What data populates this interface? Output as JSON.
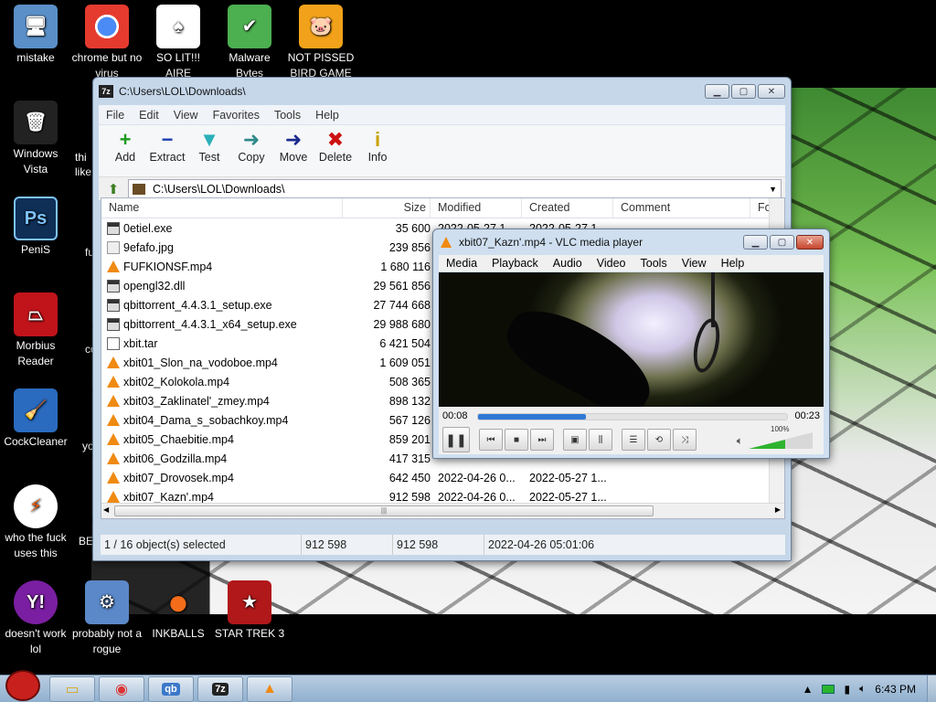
{
  "desktop": {
    "icons": [
      {
        "label": "mistake",
        "icon": "computer-icon"
      },
      {
        "label": "chrome but no virus",
        "icon": "chrome-icon"
      },
      {
        "label": "SO LIT!!! AIRE",
        "icon": "solitaire-icon"
      },
      {
        "label": "Malware Bytes",
        "icon": "shield-icon"
      },
      {
        "label": "NOT PISSED BIRD GAME",
        "icon": "pig-icon"
      },
      {
        "label": "Windows Vista",
        "icon": "trash-icon"
      },
      {
        "label": "PeniS",
        "icon": "photoshop-icon"
      },
      {
        "label": "Morbius Reader",
        "icon": "pdf-icon"
      },
      {
        "label": "CockCleaner",
        "icon": "broom-icon"
      },
      {
        "label": "who the fuck uses this",
        "icon": "lightning-icon"
      },
      {
        "label": "doesn't work lol",
        "icon": "yahoo-icon"
      },
      {
        "label": "probably not a rogue",
        "icon": "gears-icon"
      },
      {
        "label": "INKBALLS",
        "icon": "ball-icon"
      },
      {
        "label": "STAR TREK 3",
        "icon": "starwars-icon"
      }
    ],
    "partial_labels": [
      "thi",
      "like",
      "fu",
      "co",
      "yo",
      "BE"
    ]
  },
  "zip": {
    "title": "C:\\Users\\LOL\\Downloads\\",
    "title_icon": "7z",
    "menu": [
      "File",
      "Edit",
      "View",
      "Favorites",
      "Tools",
      "Help"
    ],
    "toolbar": [
      {
        "label": "Add",
        "icon": "+",
        "color": "#1f9b1f"
      },
      {
        "label": "Extract",
        "icon": "−",
        "color": "#1d3fb0"
      },
      {
        "label": "Test",
        "icon": "▼",
        "color": "#2bb0b8"
      },
      {
        "label": "Copy",
        "icon": "➜",
        "color": "#2f8a8a"
      },
      {
        "label": "Move",
        "icon": "➜",
        "color": "#1a2b8f"
      },
      {
        "label": "Delete",
        "icon": "✖",
        "color": "#cc1111"
      },
      {
        "label": "Info",
        "icon": "i",
        "color": "#c9a300"
      }
    ],
    "address": "C:\\Users\\LOL\\Downloads\\",
    "columns": [
      "Name",
      "Size",
      "Modified",
      "Created",
      "Comment",
      "Fo"
    ],
    "files": [
      {
        "name": "0etiel.exe",
        "size": "35 600",
        "modified": "2022-05-27 1...",
        "created": "2022-05-27 1...",
        "type": "exe"
      },
      {
        "name": "9efafo.jpg",
        "size": "239 856",
        "modified": "",
        "created": "",
        "type": "img"
      },
      {
        "name": "FUFKIONSF.mp4",
        "size": "1 680 116",
        "modified": "",
        "created": "",
        "type": "vlc"
      },
      {
        "name": "opengl32.dll",
        "size": "29 561 856",
        "modified": "",
        "created": "",
        "type": "exe"
      },
      {
        "name": "qbittorrent_4.4.3.1_setup.exe",
        "size": "27 744 668",
        "modified": "",
        "created": "",
        "type": "exe"
      },
      {
        "name": "qbittorrent_4.4.3.1_x64_setup.exe",
        "size": "29 988 680",
        "modified": "",
        "created": "",
        "type": "exe"
      },
      {
        "name": "xbit.tar",
        "size": "6 421 504",
        "modified": "",
        "created": "",
        "type": "tar"
      },
      {
        "name": "xbit01_Slon_na_vodoboe.mp4",
        "size": "1 609 051",
        "modified": "",
        "created": "",
        "type": "vlc"
      },
      {
        "name": "xbit02_Kolokola.mp4",
        "size": "508 365",
        "modified": "",
        "created": "",
        "type": "vlc"
      },
      {
        "name": "xbit03_Zaklinatel'_zmey.mp4",
        "size": "898 132",
        "modified": "",
        "created": "",
        "type": "vlc"
      },
      {
        "name": "xbit04_Dama_s_sobachkoy.mp4",
        "size": "567 126",
        "modified": "",
        "created": "",
        "type": "vlc"
      },
      {
        "name": "xbit05_Chaebitie.mp4",
        "size": "859 201",
        "modified": "",
        "created": "",
        "type": "vlc"
      },
      {
        "name": "xbit06_Godzilla.mp4",
        "size": "417 315",
        "modified": "",
        "created": "",
        "type": "vlc"
      },
      {
        "name": "xbit07_Drovosek.mp4",
        "size": "642 450",
        "modified": "2022-04-26 0...",
        "created": "2022-05-27 1...",
        "type": "vlc"
      },
      {
        "name": "xbit07_Kazn'.mp4",
        "size": "912 598",
        "modified": "2022-04-26 0...",
        "created": "2022-05-27 1...",
        "type": "vlc"
      }
    ],
    "status": [
      "1 / 16 object(s) selected",
      "912 598",
      "912 598",
      "2022-04-26 05:01:06"
    ]
  },
  "vlc": {
    "title": "xbit07_Kazn'.mp4 - VLC media player",
    "menu": [
      "Media",
      "Playback",
      "Audio",
      "Video",
      "Tools",
      "View",
      "Help"
    ],
    "elapsed": "00:08",
    "total": "00:23",
    "progress": 0.35,
    "volume_label": "100%",
    "volume": 1.0
  },
  "taskbar": {
    "items": [
      "folder-icon",
      "chrome-icon",
      "qbittorrent-icon",
      "7zip-icon",
      "vlc-icon"
    ],
    "item_labels": [
      "",
      "",
      "qb",
      "7z",
      ""
    ],
    "clock": "6:43 PM"
  }
}
